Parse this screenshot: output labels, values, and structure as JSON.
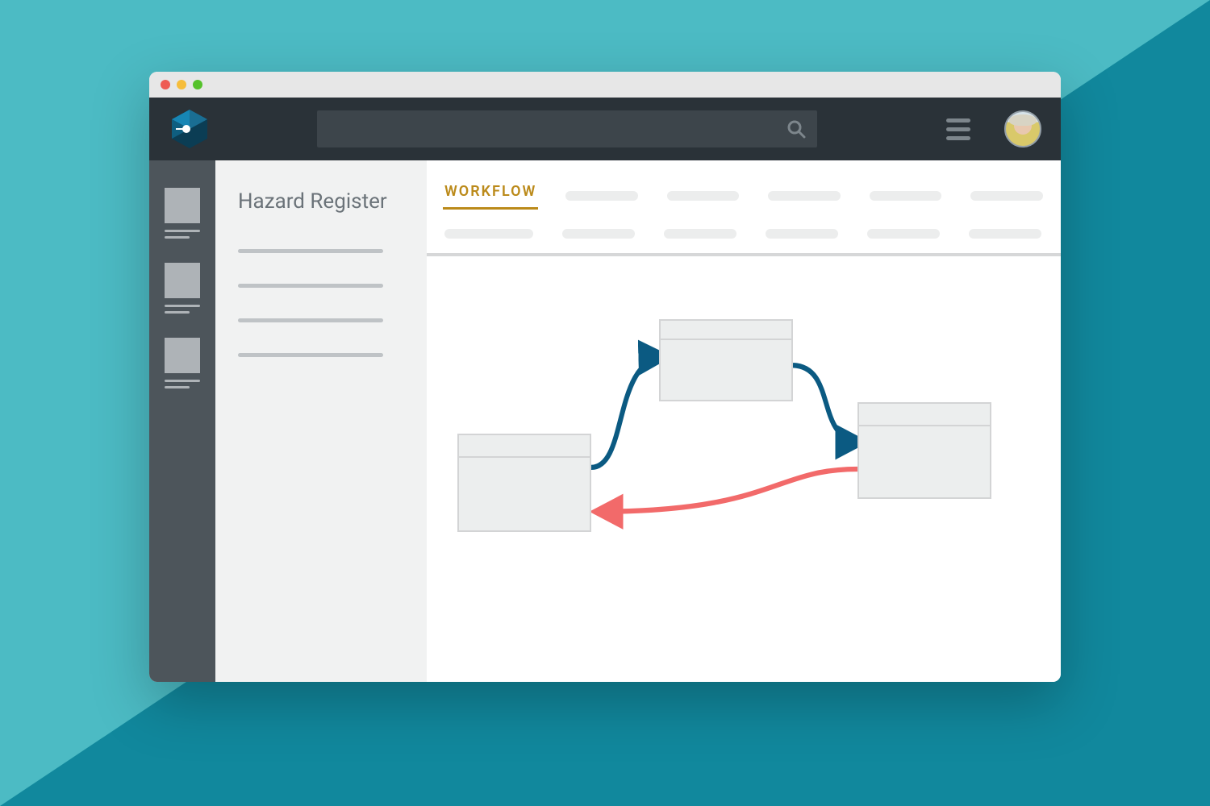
{
  "sidebar": {
    "title": "Hazard Register"
  },
  "tabs": {
    "active_label": "WORKFLOW"
  },
  "workflow": {
    "nodes": [
      {
        "id": "node-1"
      },
      {
        "id": "node-2"
      },
      {
        "id": "node-3"
      }
    ],
    "edges": [
      {
        "from": "node-1",
        "to": "node-2",
        "color_role": "forward"
      },
      {
        "from": "node-2",
        "to": "node-3",
        "color_role": "forward"
      },
      {
        "from": "node-3",
        "to": "node-1",
        "color_role": "back"
      }
    ]
  },
  "colors": {
    "accent_tab": "#bb8a1a",
    "arrow_forward": "#0b5a82",
    "arrow_back": "#f26a6a"
  }
}
